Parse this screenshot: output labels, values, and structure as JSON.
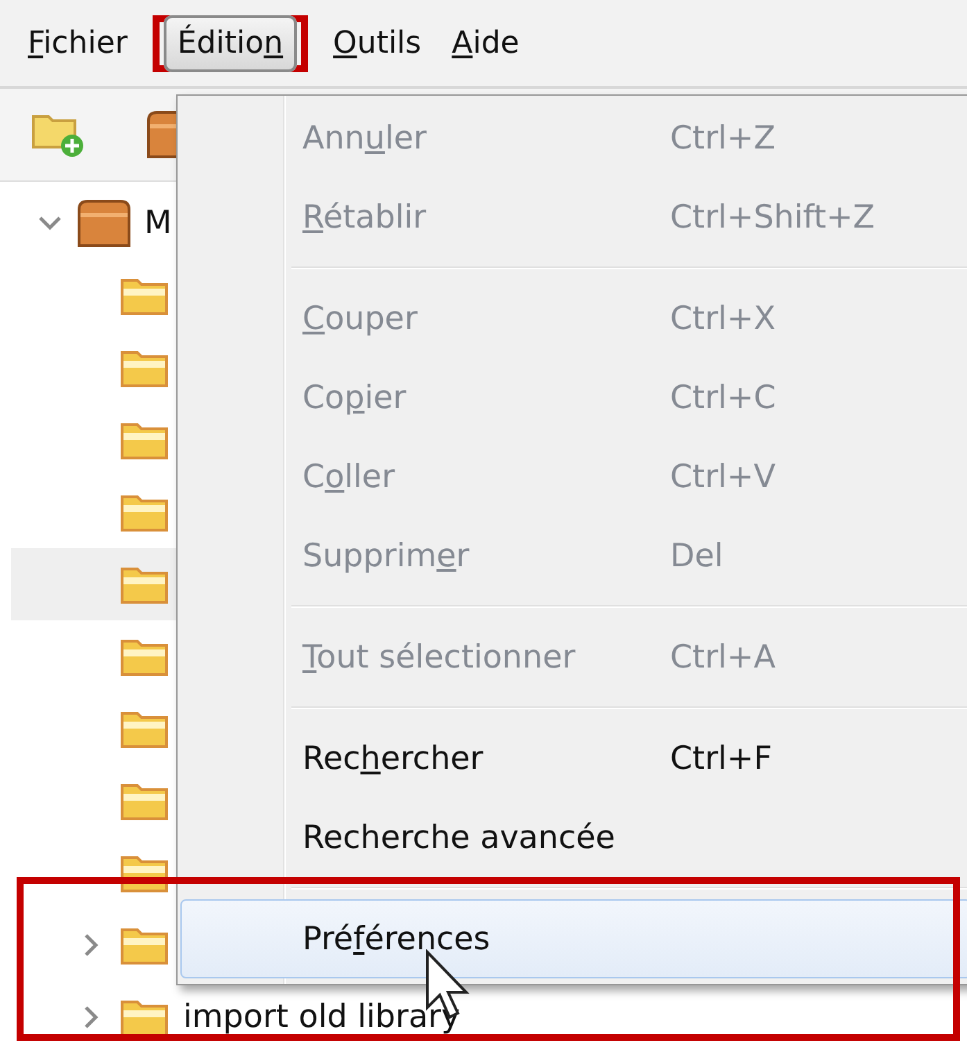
{
  "menubar": [
    {
      "label": {
        "key": "F",
        "post": "ichier"
      },
      "selected": false
    },
    {
      "label": {
        "pre": "Éditio",
        "key": "n"
      },
      "selected": true
    },
    {
      "label": {
        "key": "O",
        "post": "utils"
      },
      "selected": false
    },
    {
      "label": {
        "key": "A",
        "post": "ide"
      },
      "selected": false
    }
  ],
  "tree": {
    "name": "M",
    "expanded": true,
    "children": [
      {
        "selected": false
      },
      {
        "selected": false
      },
      {
        "selected": false
      },
      {
        "selected": false
      },
      {
        "selected": true
      },
      {
        "selected": false
      },
      {
        "selected": false
      },
      {
        "selected": false
      },
      {
        "selected": false
      },
      {
        "selected": false,
        "expanded": false
      },
      {
        "selected": false,
        "expanded": false,
        "name": "import old library"
      }
    ]
  },
  "menu": [
    {
      "kind": "item",
      "label": {
        "pre": "Ann",
        "key": "u",
        "post": "ler"
      },
      "shortcut": "Ctrl+Z",
      "disabled": true,
      "selected": false
    },
    {
      "kind": "item",
      "label": {
        "key": "R",
        "post": "établir"
      },
      "shortcut": "Ctrl+Shift+Z",
      "disabled": true,
      "selected": false
    },
    {
      "kind": "separator"
    },
    {
      "kind": "item",
      "label": {
        "key": "C",
        "post": "ouper"
      },
      "shortcut": "Ctrl+X",
      "disabled": true,
      "selected": false
    },
    {
      "kind": "item",
      "label": {
        "pre": "Co",
        "key": "p",
        "post": "ier"
      },
      "shortcut": "Ctrl+C",
      "disabled": true,
      "selected": false
    },
    {
      "kind": "item",
      "label": {
        "pre": "C",
        "key": "o",
        "post": "ller"
      },
      "shortcut": "Ctrl+V",
      "disabled": true,
      "selected": false
    },
    {
      "kind": "item",
      "label": {
        "pre": "Supprim",
        "key": "e",
        "post": "r"
      },
      "shortcut": "Del",
      "disabled": true,
      "selected": false
    },
    {
      "kind": "separator"
    },
    {
      "kind": "item",
      "label": {
        "key": "T",
        "post": "out sélectionner"
      },
      "shortcut": "Ctrl+A",
      "disabled": true,
      "selected": false
    },
    {
      "kind": "separator"
    },
    {
      "kind": "item",
      "label": {
        "pre": "Rec",
        "key": "h",
        "post": "ercher"
      },
      "shortcut": "Ctrl+F",
      "disabled": false,
      "selected": false
    },
    {
      "kind": "item",
      "label": {
        "pre": "Recherche avancée"
      },
      "disabled": false,
      "selected": false
    },
    {
      "kind": "separator"
    },
    {
      "kind": "item",
      "label": {
        "pre": "Pré",
        "key": "f",
        "post": "érences"
      },
      "disabled": false,
      "selected": true
    }
  ]
}
